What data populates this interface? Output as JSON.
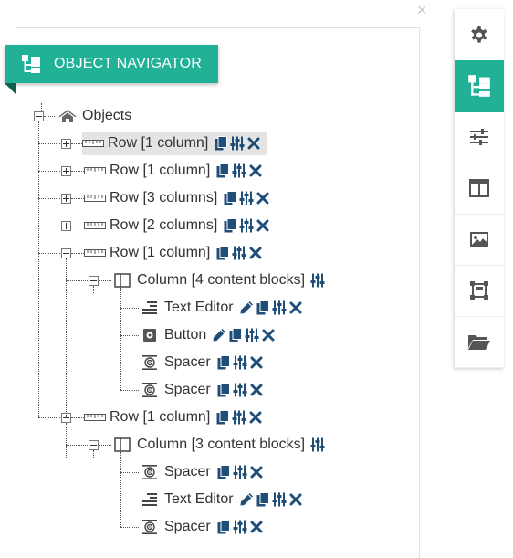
{
  "panel": {
    "title": "OBJECT NAVIGATOR",
    "close_symbol": "×",
    "accent_color": "#20b196",
    "action_color": "#1f4e79"
  },
  "tree": {
    "root": {
      "label": "Objects",
      "icon": "home-icon",
      "toggle": "collapse"
    },
    "rows": [
      {
        "label": "Row [1 column]",
        "toggle": "expand",
        "selected": true
      },
      {
        "label": "Row [1 column]",
        "toggle": "expand"
      },
      {
        "label": "Row [3 columns]",
        "toggle": "expand"
      },
      {
        "label": "Row [2 columns]",
        "toggle": "expand"
      },
      {
        "label": "Row [1 column]",
        "toggle": "collapse",
        "column": {
          "label": "Column [4 content blocks]",
          "toggle": "collapse",
          "blocks": [
            {
              "label": "Text Editor",
              "icon": "text-align-icon",
              "actions": [
                "edit",
                "copy",
                "settings",
                "delete"
              ]
            },
            {
              "label": "Button",
              "icon": "button-icon",
              "actions": [
                "edit",
                "copy",
                "settings",
                "delete"
              ]
            },
            {
              "label": "Spacer",
              "icon": "spacer-icon",
              "actions": [
                "copy",
                "settings",
                "delete"
              ]
            },
            {
              "label": "Spacer",
              "icon": "spacer-icon",
              "actions": [
                "copy",
                "settings",
                "delete"
              ]
            }
          ]
        }
      },
      {
        "label": "Row [1 column]",
        "toggle": "collapse",
        "column": {
          "label": "Column [3 content blocks]",
          "toggle": "collapse",
          "blocks": [
            {
              "label": "Spacer",
              "icon": "spacer-icon",
              "actions": [
                "copy",
                "settings",
                "delete"
              ]
            },
            {
              "label": "Text Editor",
              "icon": "text-align-icon",
              "actions": [
                "edit",
                "copy",
                "settings",
                "delete"
              ]
            },
            {
              "label": "Spacer",
              "icon": "spacer-icon",
              "actions": [
                "copy",
                "settings",
                "delete"
              ]
            }
          ]
        }
      }
    ]
  },
  "sidebar": {
    "items": [
      {
        "icon": "gear-icon",
        "active": false
      },
      {
        "icon": "navigator-icon",
        "active": true
      },
      {
        "icon": "sliders-icon",
        "active": false
      },
      {
        "icon": "columns-icon",
        "active": false
      },
      {
        "icon": "image-icon",
        "active": false
      },
      {
        "icon": "resize-icon",
        "active": false
      },
      {
        "icon": "folder-open-icon",
        "active": false
      }
    ]
  }
}
